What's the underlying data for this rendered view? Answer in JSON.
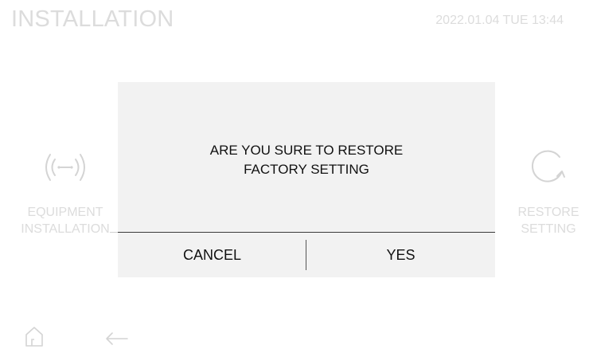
{
  "header": {
    "title": "INSTALLATION",
    "datetime": "2022.01.04 TUE 13:44"
  },
  "tiles": {
    "equipment": {
      "line1": "EQUIPMENT",
      "line2": "INSTALLATION",
      "icon": "wireless-signal-icon"
    },
    "restore": {
      "line1": "RESTORE",
      "line2": "SETTING",
      "icon": "refresh-icon"
    }
  },
  "dialog": {
    "message_line1": "ARE YOU SURE TO RESTORE",
    "message_line2": "FACTORY SETTING",
    "cancel_label": "CANCEL",
    "yes_label": "YES"
  },
  "nav": {
    "home_icon": "home-icon",
    "back_icon": "back-arrow-icon"
  },
  "colors": {
    "background": "#ffffff",
    "dimmed_text": "#dcdcdc",
    "dialog_background": "#f2f2f2",
    "dialog_text": "#111111"
  }
}
